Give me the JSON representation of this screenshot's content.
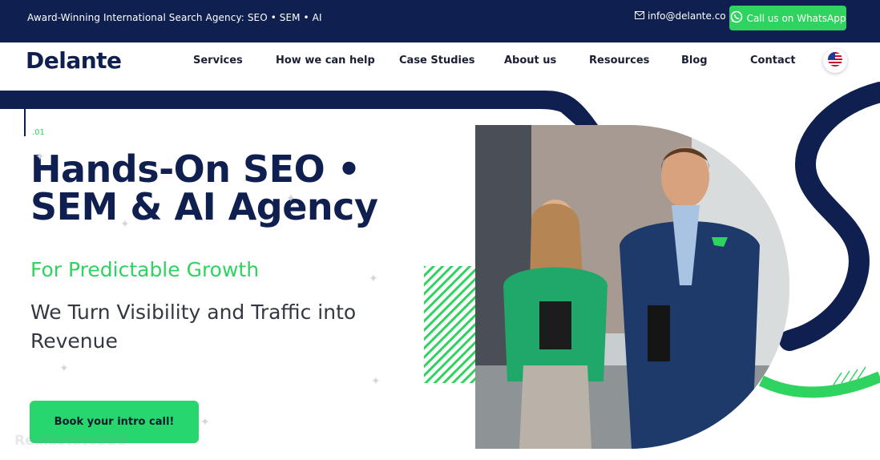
{
  "topbar": {
    "tagline": "Award-Winning International Search Agency: SEO • SEM • AI",
    "email": "info@delante.co",
    "whatsapp_label": "Call us on WhatsApp"
  },
  "nav": {
    "logo": "Delante",
    "items": [
      {
        "label": "Services"
      },
      {
        "label": "How we can help"
      },
      {
        "label": "Case Studies"
      },
      {
        "label": "About us"
      },
      {
        "label": "Resources"
      },
      {
        "label": "Blog"
      },
      {
        "label": "Contact"
      }
    ],
    "language_icon": "us-flag-icon"
  },
  "hero": {
    "index": ".01",
    "title_line1": "Hands-On SEO •",
    "title_line2": "SEM & AI Agency",
    "subtitle": "For Predictable Growth",
    "lead": "We Turn Visibility and Traffic into Revenue",
    "cta_label": "Book your intro call!"
  },
  "watermark": "RealEstateSEO",
  "colors": {
    "navy": "#0f2050",
    "green": "#2fd35f",
    "cta_green": "#27d66d"
  },
  "icons": {
    "mail": "mail-icon",
    "whatsapp": "whatsapp-icon"
  }
}
